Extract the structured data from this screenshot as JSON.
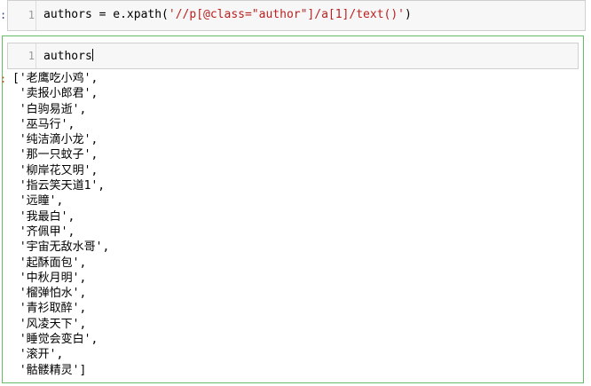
{
  "cell1": {
    "prompt": ":",
    "line_number": "1",
    "code_prefix": "authors = e.xpath(",
    "code_string": "'//p[@class=\"author\"]/a[1]/text()'",
    "code_suffix": ")"
  },
  "cell2": {
    "prompt": ":",
    "line_number": "1",
    "code": "authors",
    "output_prompt": ":",
    "output_lines": [
      "['老鹰吃小鸡',",
      " '卖报小郎君',",
      " '白驹易逝',",
      " '巫马行',",
      " '纯洁滴小龙',",
      " '那一只蚊子',",
      " '柳岸花又明',",
      " '指云笑天道1',",
      " '远瞳',",
      " '我最白',",
      " '齐佩甲',",
      " '宇宙无敌水哥',",
      " '起酥面包',",
      " '中秋月明',",
      " '榴弹怕水',",
      " '青衫取醉',",
      " '风凌天下',",
      " '睡觉会变白',",
      " '滚开',",
      " '骷髅精灵']"
    ]
  },
  "colors": {
    "selected_cell_border": "#66bb6a",
    "string_literal": "#ba2121",
    "output_prompt": "#d84315"
  }
}
